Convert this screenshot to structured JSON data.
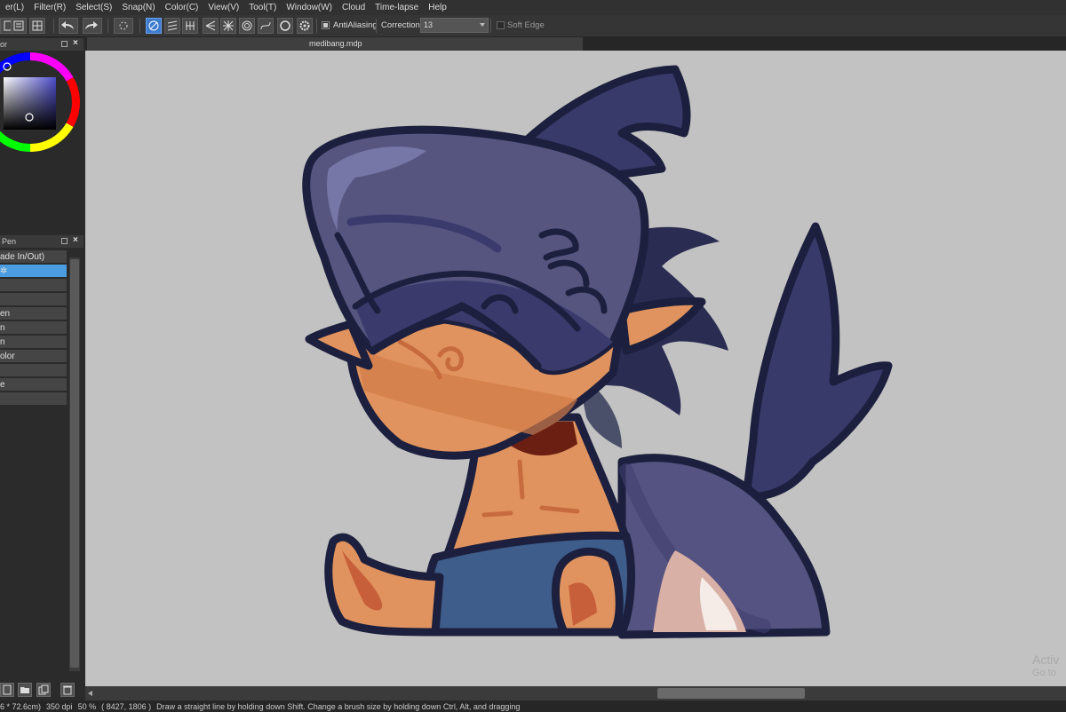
{
  "menubar": {
    "items": [
      "er(L)",
      "Filter(R)",
      "Select(S)",
      "Snap(N)",
      "Color(C)",
      "View(V)",
      "Tool(T)",
      "Window(W)",
      "Cloud",
      "Time-lapse",
      "Help"
    ]
  },
  "toolbar": {
    "antialiasing_label": "AntiAliasing",
    "correction_label": "Correction",
    "correction_value": "13",
    "soft_edge_label": "Soft Edge"
  },
  "color_panel": {
    "title": "or"
  },
  "brush_panel": {
    "title": "Pen",
    "items": [
      "ade In/Out)",
      "",
      "",
      "en",
      "n",
      "n",
      "olor",
      "",
      "e",
      ""
    ]
  },
  "document": {
    "tab_title": "medibang.mdp"
  },
  "statusbar": {
    "size": "6 * 72.6cm)",
    "dpi": "350 dpi",
    "zoom": "50 %",
    "coords": "( 8427, 1806 )",
    "hint": "Draw a straight line by holding down Shift. Change a brush size by holding down Ctrl, Alt, and dragging"
  },
  "watermark": {
    "line1": "Activ",
    "line2": "Go to"
  },
  "colors": {
    "accent": "#4a9de0",
    "canvas": "#c2c2c2",
    "outline": "#1c1f3d",
    "hat": "#565580",
    "skin": "#e0935e",
    "shorts": "#3e5d8a"
  }
}
